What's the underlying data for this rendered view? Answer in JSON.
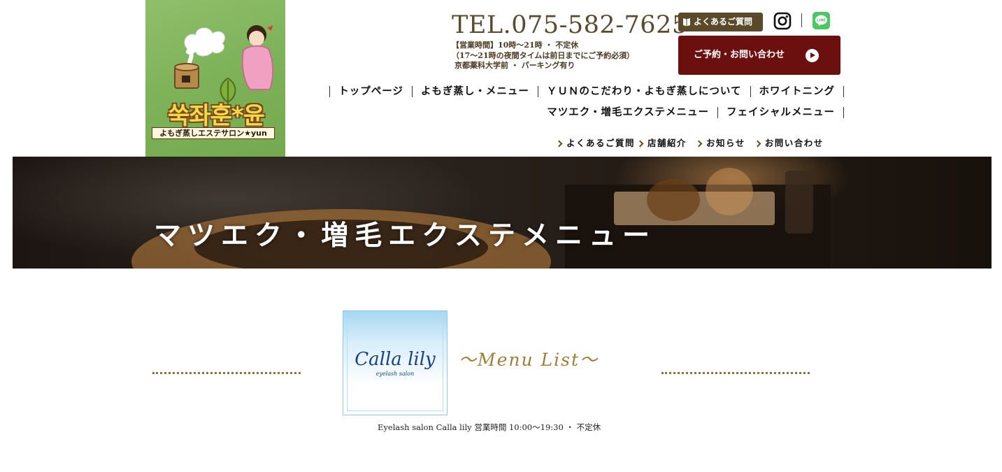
{
  "logo": {
    "title": "쑥좌훈*윤",
    "subtitle": "よもぎ蒸しエステサロン★yun"
  },
  "header": {
    "tel": "TEL.075-582-7625",
    "hours": [
      "【営業時間】10時〜21時 ・ 不定休",
      "（17〜21時の夜間タイムは前日までにご予約必須）",
      "京都薬科大学前 ・ パーキング有り"
    ],
    "faq_button": "よくあるご質問",
    "reserve_button": "ご予約・お問い合わせ"
  },
  "nav": {
    "row1": [
      "トップページ",
      "よもぎ蒸し・メニュー",
      "ＹＵＮのこだわり・よもぎ蒸しについて",
      "ホワイトニング"
    ],
    "row2": [
      "マツエク・増毛エクステメニュー",
      "フェイシャルメニュー"
    ]
  },
  "subnav": [
    "よくあるご質問",
    "店舗紹介",
    "お知らせ",
    "お問い合わせ"
  ],
  "hero": {
    "title": "マツエク・増毛エクステメニュー"
  },
  "menu": {
    "salon_name": "Calla lily",
    "salon_tag": "eyelash salon",
    "heading": "〜Menu List〜",
    "hours": "Eyelash salon Calla lily 営業時間 10:00〜19:30 ・ 不定休"
  },
  "colors": {
    "brand_brown": "#5b4a2a",
    "reserve_red": "#6b0f0f",
    "menu_gold": "#a07d38",
    "line_green": "#4cc764"
  },
  "icons": {
    "faq": "book-icon",
    "instagram": "instagram-icon",
    "line": "line-icon",
    "reserve": "play-circle-icon",
    "subnav": "chevron-right-icon"
  }
}
